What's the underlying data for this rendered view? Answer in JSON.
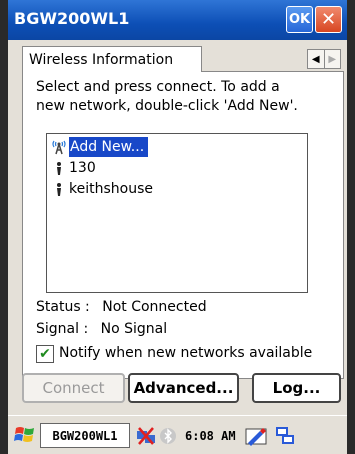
{
  "window": {
    "title": "BGW200WL1",
    "ok_label": "OK",
    "close_label": "✕"
  },
  "tab": {
    "label": "Wireless Information"
  },
  "instructions": {
    "line1": "Select and press connect.  To add a",
    "line2": "new network, double-click 'Add New'."
  },
  "networks": [
    {
      "label": "Add New...",
      "icon": "antenna-icon",
      "selected": true
    },
    {
      "label": "130",
      "icon": "signal-person-icon",
      "selected": false
    },
    {
      "label": "keithshouse",
      "icon": "signal-person-icon",
      "selected": false
    }
  ],
  "status": {
    "status_label": "Status :",
    "status_value": "Not Connected",
    "signal_label": "Signal  :",
    "signal_value": "No Signal"
  },
  "notify": {
    "label": "Notify when new networks available",
    "checked": true
  },
  "buttons": {
    "connect": "Connect",
    "advanced": "Advanced...",
    "log": "Log..."
  },
  "taskbar": {
    "task_label": "BGW200WL1",
    "clock": "6:08 AM"
  },
  "colors": {
    "title_bar": "#0d4fb6",
    "selection": "#1848c8",
    "check_green": "#1f8a1f"
  }
}
